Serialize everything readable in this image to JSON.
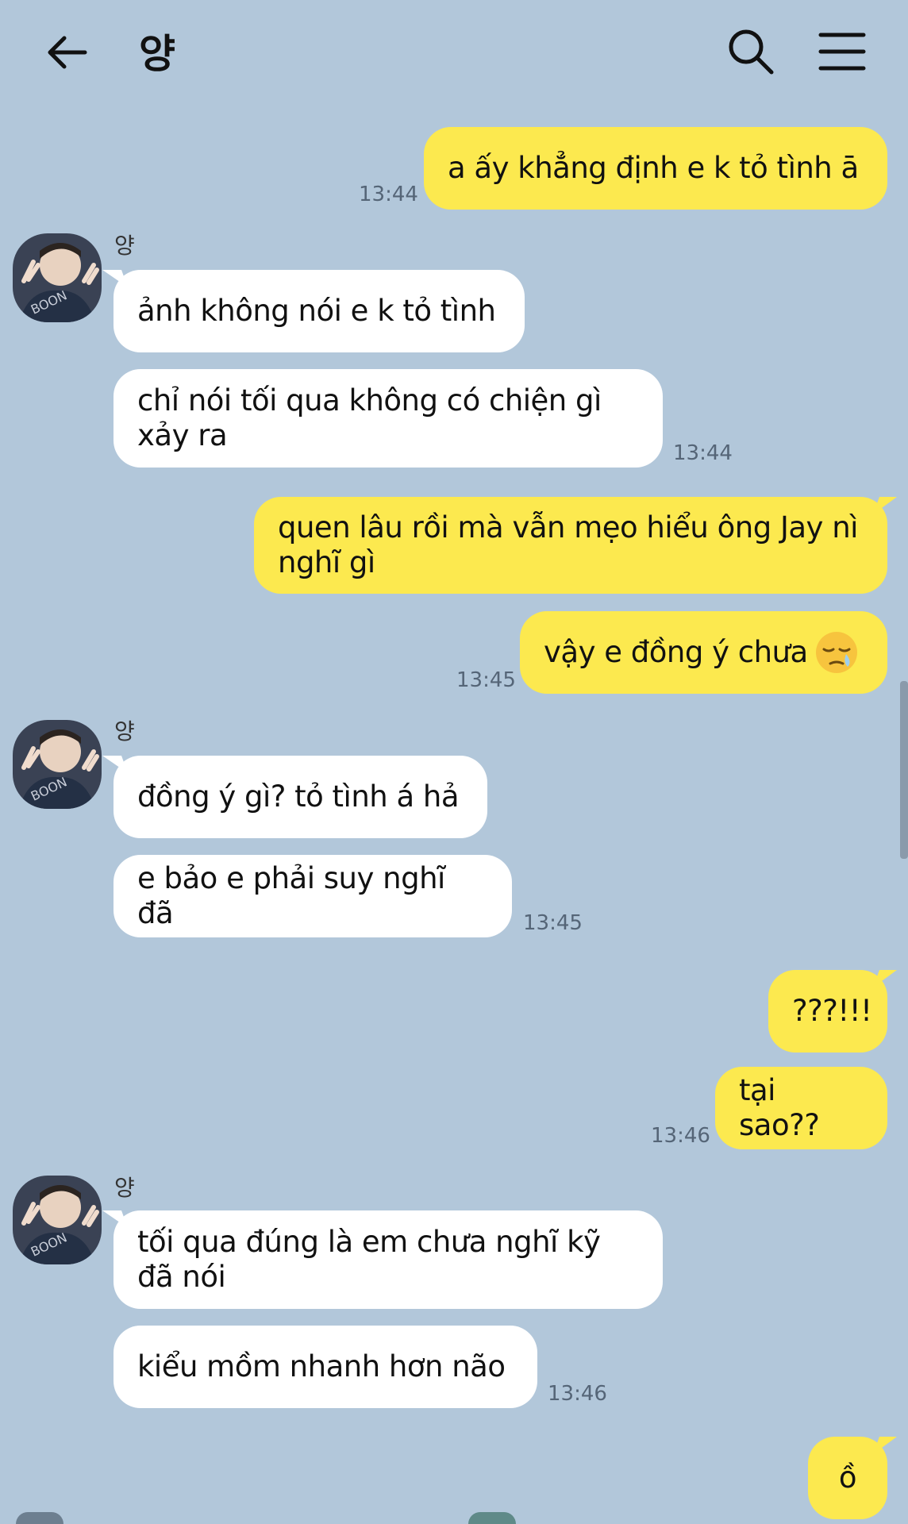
{
  "header": {
    "title": "양",
    "back_icon": "arrow-left-icon",
    "search_icon": "search-icon",
    "menu_icon": "hamburger-menu-icon"
  },
  "colors": {
    "background": "#b2c7da",
    "my_bubble": "#fce94f",
    "their_bubble": "#ffffff"
  },
  "sender_name": "양",
  "messages": [
    {
      "from": "me",
      "text": "a ấy khẳng định e k tỏ tình ā",
      "time": "13:44"
    },
    {
      "from": "them",
      "text": "ảnh không nói e k tỏ tình"
    },
    {
      "from": "them",
      "text": "chỉ nói tối qua không có chiện gì xảy ra",
      "time": "13:44"
    },
    {
      "from": "me",
      "text": "quen lâu rồi mà vẫn mẹo hiểu ông Jay nì nghĩ gì"
    },
    {
      "from": "me",
      "text": "vậy e đồng ý chưa",
      "time": "13:45"
    },
    {
      "from": "them",
      "text": "đồng ý gì? tỏ tình á hả"
    },
    {
      "from": "them",
      "text": "e bảo e phải suy nghĩ đã",
      "time": "13:45"
    },
    {
      "from": "me",
      "text": "???!!!"
    },
    {
      "from": "me",
      "text": "tại sao??",
      "time": "13:46"
    },
    {
      "from": "them",
      "text": "tối qua đúng là em chưa nghĩ kỹ đã nói"
    },
    {
      "from": "them",
      "text": "kiểu mồm nhanh hơn não",
      "time": "13:46"
    },
    {
      "from": "me",
      "text": "ồ"
    }
  ]
}
